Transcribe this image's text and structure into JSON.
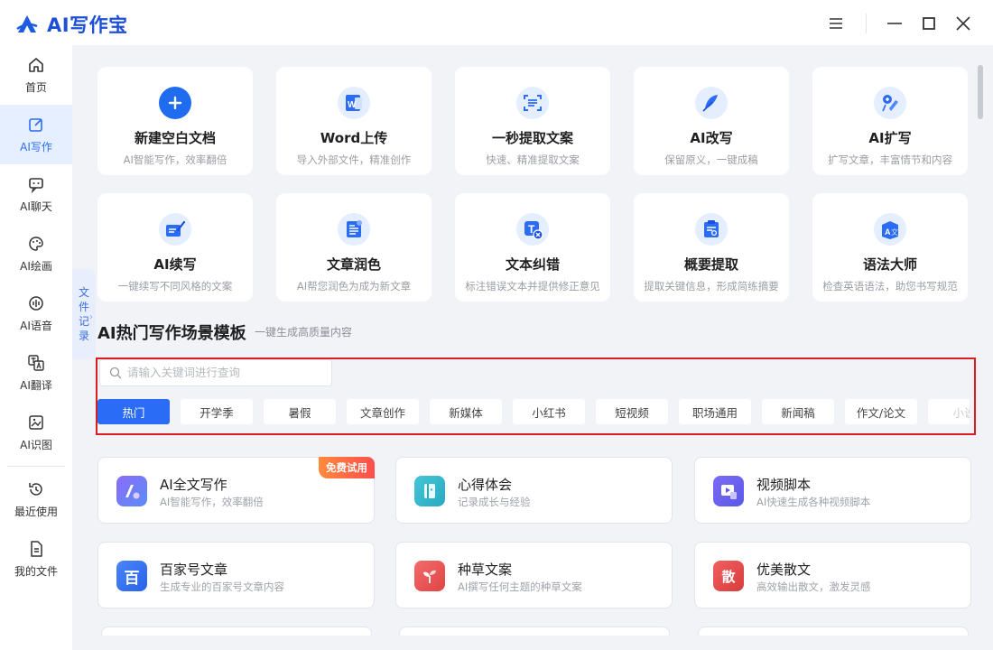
{
  "app": {
    "title": "AI写作宝"
  },
  "sidebar": {
    "items": [
      {
        "label": "首页",
        "icon": "home-icon"
      },
      {
        "label": "AI写作",
        "icon": "edit-icon",
        "active": true
      },
      {
        "label": "AI聊天",
        "icon": "chat-icon"
      },
      {
        "label": "AI绘画",
        "icon": "palette-icon"
      },
      {
        "label": "AI语音",
        "icon": "voice-icon"
      },
      {
        "label": "AI翻译",
        "icon": "translate-icon"
      },
      {
        "label": "AI识图",
        "icon": "image-recognition-icon"
      },
      {
        "label": "最近使用",
        "icon": "history-icon"
      },
      {
        "label": "我的文件",
        "icon": "file-icon"
      }
    ]
  },
  "file_record_tab": {
    "chars": [
      "文",
      "件",
      "记",
      "录"
    ]
  },
  "features": [
    {
      "title": "新建空白文档",
      "subtitle": "AI智能写作，效率翻倍",
      "icon": "plus-icon"
    },
    {
      "title": "Word上传",
      "subtitle": "导入外部文件，精准创作",
      "icon": "word-icon"
    },
    {
      "title": "一秒提取文案",
      "subtitle": "快速、精准提取文案",
      "icon": "scan-icon"
    },
    {
      "title": "AI改写",
      "subtitle": "保留原义，一键成稿",
      "icon": "feather-icon"
    },
    {
      "title": "AI扩写",
      "subtitle": "扩写文章，丰富情节和内容",
      "icon": "expand-icon"
    },
    {
      "title": "AI续写",
      "subtitle": "一键续写不同风格的文案",
      "icon": "continue-icon"
    },
    {
      "title": "文章润色",
      "subtitle": "AI帮您润色为成为新文章",
      "icon": "polish-icon"
    },
    {
      "title": "文本纠错",
      "subtitle": "标注错误文本并提供修正意见",
      "icon": "correct-icon"
    },
    {
      "title": "概要提取",
      "subtitle": "提取关键信息，形成简练摘要",
      "icon": "summary-icon"
    },
    {
      "title": "语法大师",
      "subtitle": "检查英语语法，助您书写规范",
      "icon": "grammar-icon"
    }
  ],
  "templates_section": {
    "title": "AI热门写作场景模板",
    "subtitle": "一键生成高质量内容",
    "search_placeholder": "请输入关键词进行查询",
    "tags": [
      "热门",
      "开学季",
      "暑假",
      "文章创作",
      "新媒体",
      "小红书",
      "短视频",
      "职场通用",
      "新闻稿",
      "作文/论文",
      "小说"
    ],
    "active_tag": "热门"
  },
  "templates": [
    {
      "title": "AI全文写作",
      "subtitle": "AI智能写作，效率翻倍",
      "icon": "ai-write-icon",
      "badge": "免费试用",
      "color": "#7b5cf0"
    },
    {
      "title": "心得体会",
      "subtitle": "记录成长与经验",
      "icon": "notebook-icon",
      "color": "#33b6c9"
    },
    {
      "title": "视频脚本",
      "subtitle": "AI快速生成各种视频脚本",
      "icon": "video-script-icon",
      "color": "#6a5cf0"
    },
    {
      "title": "百家号文章",
      "subtitle": "生成专业的百家号文章内容",
      "icon": "baijiahao-icon",
      "glyph": "百",
      "color": "#3a74f0"
    },
    {
      "title": "种草文案",
      "subtitle": "AI撰写任何主题的种草文案",
      "icon": "sprout-icon",
      "color": "#ef5b5b"
    },
    {
      "title": "优美散文",
      "subtitle": "高效输出散文，激发灵感",
      "icon": "prose-icon",
      "glyph": "散",
      "color": "#e84c4c"
    }
  ]
}
